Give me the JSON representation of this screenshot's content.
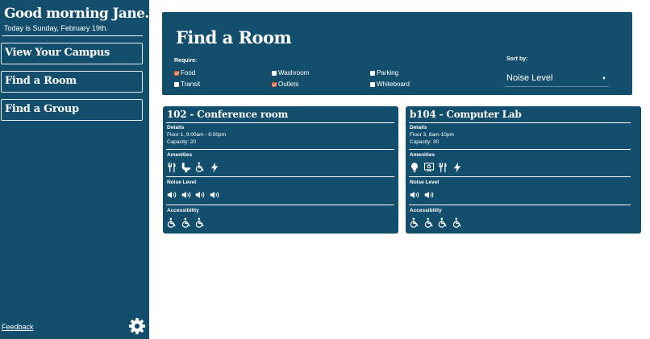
{
  "sidebar": {
    "greeting": "Good morning Jane.",
    "date_line": "Today is Sunday, February 19th.",
    "nav": [
      "View Your Campus",
      "Find a Room",
      "Find a Group"
    ],
    "feedback": "Feedback",
    "settings_icon": "gear-icon"
  },
  "finder": {
    "title": "Find a Room",
    "require_label": "Require:",
    "filters": [
      {
        "label": "Food",
        "checked": true
      },
      {
        "label": "Washroom",
        "checked": false
      },
      {
        "label": "Parking",
        "checked": false
      },
      {
        "label": "Transit",
        "checked": false
      },
      {
        "label": "Outlets",
        "checked": true
      },
      {
        "label": "Whiteboard",
        "checked": false
      }
    ],
    "sort_label": "Sort by:",
    "sort_value": "Noise Level"
  },
  "rooms": [
    {
      "title": "102 - Conference room",
      "details_label": "Details",
      "details": [
        "Floor 1, 9:00am - 6:00pm",
        "Capacity: 20"
      ],
      "amenities_label": "Amenities",
      "amenities": [
        "utensils-icon",
        "toilet-icon",
        "wheelchair-icon",
        "lightning-icon"
      ],
      "noise_label": "Noise Level",
      "noise": 4,
      "accessibility_label": "Accessibility",
      "accessibility": 3
    },
    {
      "title": "b104 - Computer Lab",
      "details_label": "Details",
      "details": [
        "Floor 3, 8am-10pm",
        "Capacity: 30"
      ],
      "amenities_label": "Amenities",
      "amenities": [
        "lightbulb-icon",
        "projector-screen-icon",
        "utensils-icon",
        "lightning-icon"
      ],
      "noise_label": "Noise Level",
      "noise": 2,
      "accessibility_label": "Accessibility",
      "accessibility": 4
    }
  ],
  "colors": {
    "panel": "#134f6c",
    "checked": "#e85a27",
    "background": "#ffffff"
  }
}
